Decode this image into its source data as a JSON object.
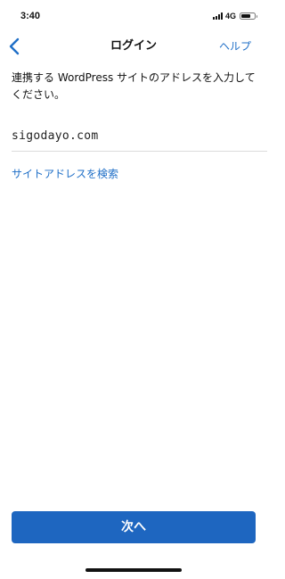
{
  "status_bar": {
    "time": "3:40",
    "network": "4G",
    "battery_level": 0.7,
    "icons": [
      "signal-icon",
      "battery-icon"
    ]
  },
  "nav": {
    "back_icon": "chevron-left-icon",
    "title": "ログイン",
    "help_label": "ヘルプ"
  },
  "main": {
    "instruction": "連携する WordPress サイトのアドレスを入力してください。",
    "site_address_value": "sigodayo.com",
    "search_site_label": "サイトアドレスを検索"
  },
  "footer": {
    "next_label": "次へ"
  },
  "colors": {
    "accent": "#1f6fc7",
    "button": "#1e66c0",
    "text": "#111111",
    "divider": "#dcdcdc"
  }
}
